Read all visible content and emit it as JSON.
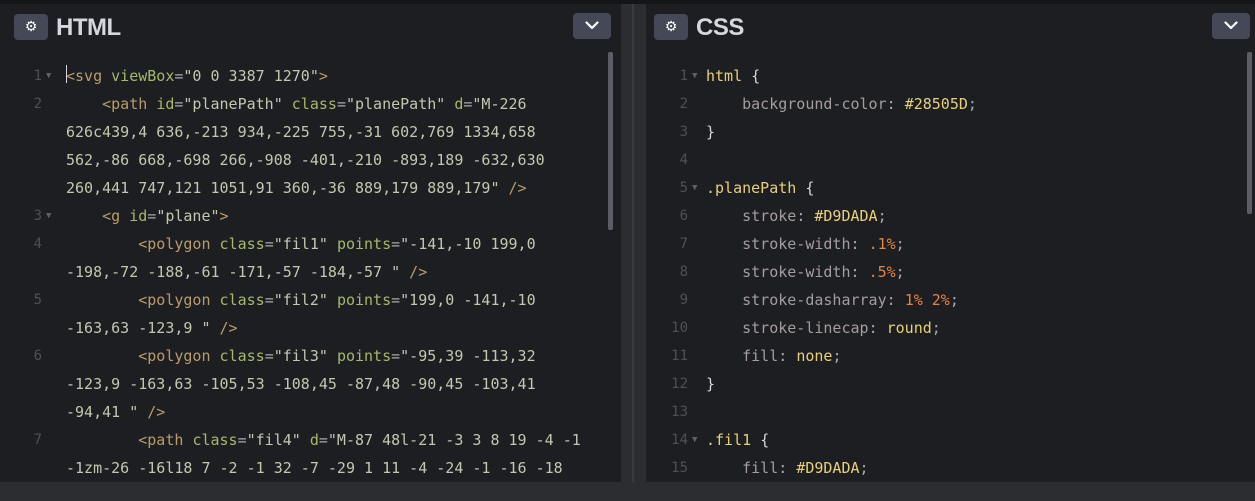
{
  "html_panel": {
    "title": "HTML",
    "settings_icon": "gear-icon",
    "collapse_icon": "chevron-down-icon",
    "lines": [
      {
        "num": "1",
        "fold": "▼",
        "indent": "",
        "tokens": [
          [
            "t-tag",
            "<svg "
          ],
          [
            "t-attr",
            "viewBox"
          ],
          [
            "t-punct",
            "="
          ],
          [
            "t-str",
            "\"0 0 3387 1270\""
          ],
          [
            "t-tag",
            ">"
          ]
        ]
      },
      {
        "num": "2",
        "fold": "",
        "indent": "    ",
        "tokens": [
          [
            "t-tag",
            "<path "
          ],
          [
            "t-attr",
            "id"
          ],
          [
            "t-punct",
            "="
          ],
          [
            "t-str",
            "\"planePath\" "
          ],
          [
            "t-attr",
            "class"
          ],
          [
            "t-punct",
            "="
          ],
          [
            "t-str",
            "\"planePath\" "
          ],
          [
            "t-attr",
            "d"
          ],
          [
            "t-punct",
            "="
          ],
          [
            "t-str",
            "\"M-226"
          ]
        ]
      },
      {
        "num": "",
        "fold": "",
        "indent": "",
        "tokens": [
          [
            "t-str",
            "626c439,4 636,-213 934,-225 755,-31 602,769 1334,658"
          ]
        ]
      },
      {
        "num": "",
        "fold": "",
        "indent": "",
        "tokens": [
          [
            "t-str",
            "562,-86 668,-698 266,-908 -401,-210 -893,189 -632,630"
          ]
        ]
      },
      {
        "num": "",
        "fold": "",
        "indent": "",
        "tokens": [
          [
            "t-str",
            "260,441 747,121 1051,91 360,-36 889,179 889,179\" "
          ],
          [
            "t-tag",
            "/>"
          ]
        ]
      },
      {
        "num": "3",
        "fold": "▼",
        "indent": "    ",
        "tokens": [
          [
            "t-tag",
            "<g "
          ],
          [
            "t-attr",
            "id"
          ],
          [
            "t-punct",
            "="
          ],
          [
            "t-str",
            "\"plane\""
          ],
          [
            "t-tag",
            ">"
          ]
        ]
      },
      {
        "num": "4",
        "fold": "",
        "indent": "        ",
        "tokens": [
          [
            "t-tag",
            "<polygon "
          ],
          [
            "t-attr",
            "class"
          ],
          [
            "t-punct",
            "="
          ],
          [
            "t-str",
            "\"fil1\" "
          ],
          [
            "t-attr",
            "points"
          ],
          [
            "t-punct",
            "="
          ],
          [
            "t-str",
            "\"-141,-10 199,0"
          ]
        ]
      },
      {
        "num": "",
        "fold": "",
        "indent": "",
        "tokens": [
          [
            "t-str",
            "-198,-72 -188,-61 -171,-57 -184,-57 \" "
          ],
          [
            "t-tag",
            "/>"
          ]
        ]
      },
      {
        "num": "5",
        "fold": "",
        "indent": "        ",
        "tokens": [
          [
            "t-tag",
            "<polygon "
          ],
          [
            "t-attr",
            "class"
          ],
          [
            "t-punct",
            "="
          ],
          [
            "t-str",
            "\"fil2\" "
          ],
          [
            "t-attr",
            "points"
          ],
          [
            "t-punct",
            "="
          ],
          [
            "t-str",
            "\"199,0 -141,-10"
          ]
        ]
      },
      {
        "num": "",
        "fold": "",
        "indent": "",
        "tokens": [
          [
            "t-str",
            "-163,63 -123,9 \" "
          ],
          [
            "t-tag",
            "/>"
          ]
        ]
      },
      {
        "num": "6",
        "fold": "",
        "indent": "        ",
        "tokens": [
          [
            "t-tag",
            "<polygon "
          ],
          [
            "t-attr",
            "class"
          ],
          [
            "t-punct",
            "="
          ],
          [
            "t-str",
            "\"fil3\" "
          ],
          [
            "t-attr",
            "points"
          ],
          [
            "t-punct",
            "="
          ],
          [
            "t-str",
            "\"-95,39 -113,32"
          ]
        ]
      },
      {
        "num": "",
        "fold": "",
        "indent": "",
        "tokens": [
          [
            "t-str",
            "-123,9 -163,63 -105,53 -108,45 -87,48 -90,45 -103,41"
          ]
        ]
      },
      {
        "num": "",
        "fold": "",
        "indent": "",
        "tokens": [
          [
            "t-str",
            "-94,41 \" "
          ],
          [
            "t-tag",
            "/>"
          ]
        ]
      },
      {
        "num": "7",
        "fold": "",
        "indent": "        ",
        "tokens": [
          [
            "t-tag",
            "<path "
          ],
          [
            "t-attr",
            "class"
          ],
          [
            "t-punct",
            "="
          ],
          [
            "t-str",
            "\"fil4\" "
          ],
          [
            "t-attr",
            "d"
          ],
          [
            "t-punct",
            "="
          ],
          [
            "t-str",
            "\"M-87 48l-21 -3 3 8 19 -4 -1"
          ]
        ]
      },
      {
        "num": "",
        "fold": "",
        "indent": "",
        "tokens": [
          [
            "t-str",
            "-1zm-26 -16l18 7 -2 -1 32 -7 -29 1 11 -4 -24 -1 -16 -18"
          ]
        ]
      }
    ]
  },
  "css_panel": {
    "title": "CSS",
    "settings_icon": "gear-icon",
    "collapse_icon": "chevron-down-icon",
    "lines": [
      {
        "num": "1",
        "fold": "▼",
        "indent": "",
        "tokens": [
          [
            "t-sel",
            "html "
          ],
          [
            "t-brace",
            "{"
          ]
        ]
      },
      {
        "num": "2",
        "fold": "",
        "indent": "    ",
        "tokens": [
          [
            "t-prop",
            "background-color"
          ],
          [
            "t-punct",
            ": "
          ],
          [
            "t-val",
            "#28505D"
          ],
          [
            "t-punct",
            ";"
          ]
        ]
      },
      {
        "num": "3",
        "fold": "",
        "indent": "",
        "tokens": [
          [
            "t-brace",
            "}"
          ]
        ]
      },
      {
        "num": "4",
        "fold": "",
        "indent": "",
        "tokens": []
      },
      {
        "num": "5",
        "fold": "▼",
        "indent": "",
        "tokens": [
          [
            "t-sel",
            ".planePath "
          ],
          [
            "t-brace",
            "{"
          ]
        ]
      },
      {
        "num": "6",
        "fold": "",
        "indent": "    ",
        "tokens": [
          [
            "t-prop",
            "stroke"
          ],
          [
            "t-punct",
            ": "
          ],
          [
            "t-val",
            "#D9DADA"
          ],
          [
            "t-punct",
            ";"
          ]
        ]
      },
      {
        "num": "7",
        "fold": "",
        "indent": "    ",
        "tokens": [
          [
            "t-prop",
            "stroke-width"
          ],
          [
            "t-punct",
            ": "
          ],
          [
            "t-num",
            ".1%"
          ],
          [
            "t-punct",
            ";"
          ]
        ]
      },
      {
        "num": "8",
        "fold": "",
        "indent": "    ",
        "tokens": [
          [
            "t-prop",
            "stroke-width"
          ],
          [
            "t-punct",
            ": "
          ],
          [
            "t-num",
            ".5%"
          ],
          [
            "t-punct",
            ";"
          ]
        ]
      },
      {
        "num": "9",
        "fold": "",
        "indent": "    ",
        "tokens": [
          [
            "t-prop",
            "stroke-dasharray"
          ],
          [
            "t-punct",
            ": "
          ],
          [
            "t-num",
            "1% 2%"
          ],
          [
            "t-punct",
            ";"
          ]
        ]
      },
      {
        "num": "10",
        "fold": "",
        "indent": "    ",
        "tokens": [
          [
            "t-prop",
            "stroke-linecap"
          ],
          [
            "t-punct",
            ": "
          ],
          [
            "t-val",
            "round"
          ],
          [
            "t-punct",
            ";"
          ]
        ]
      },
      {
        "num": "11",
        "fold": "",
        "indent": "    ",
        "tokens": [
          [
            "t-prop",
            "fill"
          ],
          [
            "t-punct",
            ": "
          ],
          [
            "t-val",
            "none"
          ],
          [
            "t-punct",
            ";"
          ]
        ]
      },
      {
        "num": "12",
        "fold": "",
        "indent": "",
        "tokens": [
          [
            "t-brace",
            "}"
          ]
        ]
      },
      {
        "num": "13",
        "fold": "",
        "indent": "",
        "tokens": []
      },
      {
        "num": "14",
        "fold": "▼",
        "indent": "",
        "tokens": [
          [
            "t-sel",
            ".fil1 "
          ],
          [
            "t-brace",
            "{"
          ]
        ]
      },
      {
        "num": "15",
        "fold": "",
        "indent": "    ",
        "tokens": [
          [
            "t-prop",
            "fill"
          ],
          [
            "t-punct",
            ": "
          ],
          [
            "t-val",
            "#D9DADA"
          ],
          [
            "t-punct",
            ";"
          ]
        ]
      }
    ]
  }
}
